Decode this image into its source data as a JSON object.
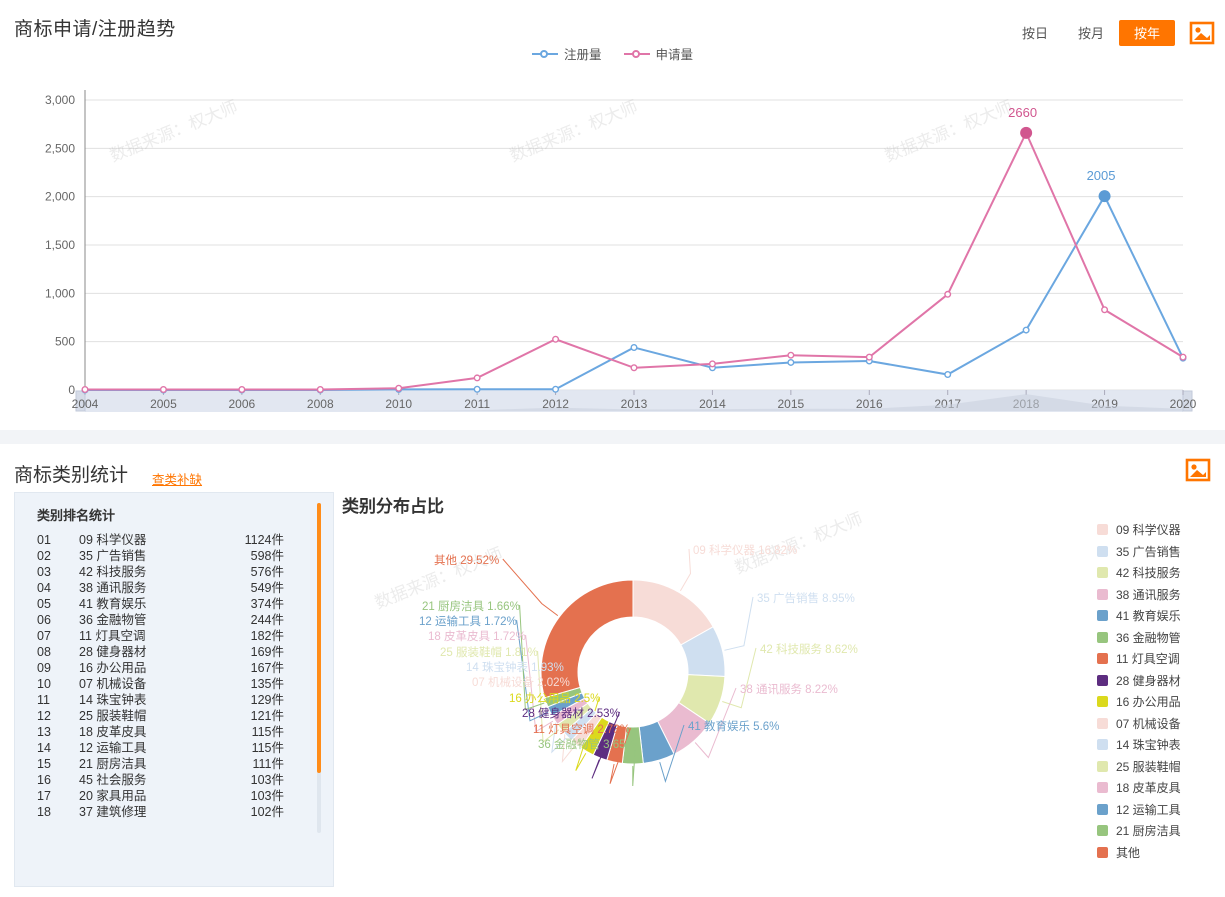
{
  "trend": {
    "title": "商标申请/注册趋势",
    "controls": [
      {
        "label": "按日",
        "active": false
      },
      {
        "label": "按月",
        "active": false
      },
      {
        "label": "按年",
        "active": true
      }
    ],
    "export_icon": "image-export-icon",
    "legend": [
      {
        "label": "注册量",
        "color": "#6ba7e0"
      },
      {
        "label": "申请量",
        "color": "#e075a8"
      }
    ],
    "peak_labels": [
      {
        "value": "2660",
        "color": "#d1568f"
      },
      {
        "value": "2005",
        "color": "#5b9bd5"
      }
    ],
    "watermark": "数据来源：权大师"
  },
  "chart_data": {
    "type": "line",
    "title": "商标申请/注册趋势",
    "xlabel": "",
    "ylabel": "",
    "ylim": [
      0,
      3000
    ],
    "yticks": [
      "0",
      "500",
      "1,000",
      "1,500",
      "2,000",
      "2,500",
      "3,000"
    ],
    "grid": true,
    "legend_position": "top-center",
    "categories": [
      "2004",
      "2005",
      "2006",
      "2008",
      "2010",
      "2011",
      "2012",
      "2013",
      "2014",
      "2015",
      "2016",
      "2017",
      "2018",
      "2019",
      "2020"
    ],
    "series": [
      {
        "name": "注册量",
        "color": "#6ba7e0",
        "values": [
          0,
          0,
          0,
          0,
          6,
          8,
          8,
          440,
          230,
          285,
          300,
          160,
          620,
          2005,
          330
        ]
      },
      {
        "name": "申请量",
        "color": "#e075a8",
        "values": [
          5,
          5,
          5,
          5,
          18,
          125,
          525,
          230,
          270,
          360,
          340,
          990,
          2660,
          830,
          340
        ]
      }
    ],
    "annotations": [
      {
        "series": "申请量",
        "x": "2018",
        "y": 2660,
        "text": "2660"
      },
      {
        "series": "注册量",
        "x": "2019",
        "y": 2005,
        "text": "2005"
      }
    ]
  },
  "category": {
    "title": "商标类别统计",
    "link": "查类补缺",
    "export_icon": "image-export-icon",
    "rank_header": "类别排名统计",
    "rank_rows": [
      {
        "idx": "01",
        "name": "09 科学仪器",
        "count": "1124件"
      },
      {
        "idx": "02",
        "name": "35 广告销售",
        "count": "598件"
      },
      {
        "idx": "03",
        "name": "42 科技服务",
        "count": "576件"
      },
      {
        "idx": "04",
        "name": "38 通讯服务",
        "count": "549件"
      },
      {
        "idx": "05",
        "name": "41 教育娱乐",
        "count": "374件"
      },
      {
        "idx": "06",
        "name": "36 金融物管",
        "count": "244件"
      },
      {
        "idx": "07",
        "name": "11 灯具空调",
        "count": "182件"
      },
      {
        "idx": "08",
        "name": "28 健身器材",
        "count": "169件"
      },
      {
        "idx": "09",
        "name": "16 办公用品",
        "count": "167件"
      },
      {
        "idx": "10",
        "name": "07 机械设备",
        "count": "135件"
      },
      {
        "idx": "11",
        "name": "14 珠宝钟表",
        "count": "129件"
      },
      {
        "idx": "12",
        "name": "25 服装鞋帽",
        "count": "121件"
      },
      {
        "idx": "13",
        "name": "18 皮革皮具",
        "count": "115件"
      },
      {
        "idx": "14",
        "name": "12 运输工具",
        "count": "115件"
      },
      {
        "idx": "15",
        "name": "21 厨房洁具",
        "count": "111件"
      },
      {
        "idx": "16",
        "name": "45 社会服务",
        "count": "103件"
      },
      {
        "idx": "17",
        "name": "20 家具用品",
        "count": "103件"
      },
      {
        "idx": "18",
        "name": "37 建筑修理",
        "count": "102件"
      }
    ],
    "donut_title": "类别分布占比",
    "watermark": "数据来源：权大师"
  },
  "pie_data": {
    "type": "pie",
    "title": "类别分布占比",
    "labels": [
      "09 科学仪器",
      "35 广告销售",
      "42 科技服务",
      "38 通讯服务",
      "41 教育娱乐",
      "36 金融物管",
      "11 灯具空调",
      "28 健身器材",
      "16 办公用品",
      "07 机械设备",
      "14 珠宝钟表",
      "25 服装鞋帽",
      "18 皮革皮具",
      "12 运输工具",
      "21 厨房洁具",
      "其他"
    ],
    "values": [
      16.82,
      8.95,
      8.62,
      8.22,
      5.6,
      3.65,
      2.73,
      2.53,
      2.5,
      2.02,
      1.93,
      1.81,
      1.72,
      1.72,
      1.66,
      29.52
    ],
    "colors": [
      "#f7dcd7",
      "#cfdff0",
      "#e0e8ae",
      "#eabbd0",
      "#6ba1cb",
      "#97c57e",
      "#e4714f",
      "#5d2d80",
      "#dbd91d",
      "#f7dcd7",
      "#cfdff0",
      "#e0e8ae",
      "#eabbd0",
      "#6ba1cb",
      "#97c57e",
      "#e4714f"
    ],
    "label_texts": [
      "09 科学仪器 16.82%",
      "35 广告销售 8.95%",
      "42 科技服务 8.62%",
      "38 通讯服务 8.22%",
      "41 教育娱乐 5.6%",
      "36 金融物管 3.65%",
      "11 灯具空调 2.73%",
      "28 健身器材 2.53%",
      "16 办公用品 2.5%",
      "07 机械设备 2.02%",
      "14 珠宝钟表 1.93%",
      "25 服装鞋帽 1.81%",
      "18 皮革皮具 1.72%",
      "12 运输工具 1.72%",
      "21 厨房洁具 1.66%",
      "其他 29.52%"
    ],
    "legend_position": "right"
  }
}
